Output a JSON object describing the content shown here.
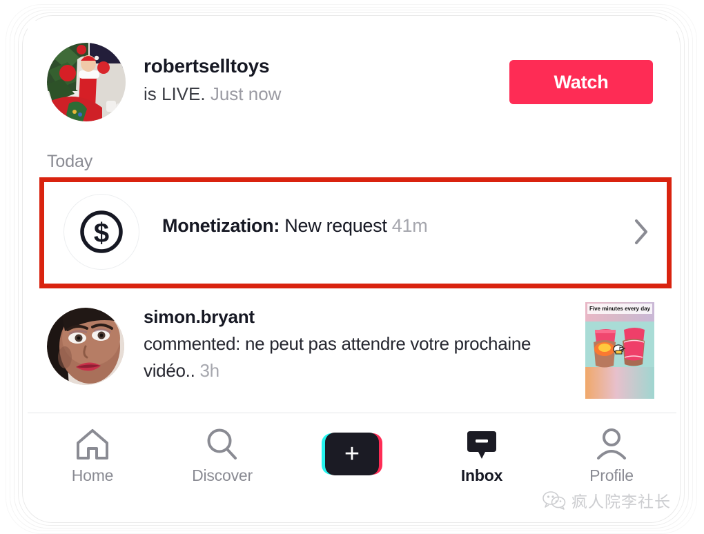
{
  "live_notification": {
    "avatar_alt": "christmas-stocking-avatar",
    "username": "robertselltoys",
    "status_text": "is LIVE.",
    "time_text": "Just now",
    "watch_label": "Watch",
    "watch_color": "#fe2c55"
  },
  "section": {
    "today_label": "Today"
  },
  "monetization": {
    "icon": "dollar-circle-icon",
    "title": "Monetization:",
    "detail": "New request",
    "time": "41m",
    "chevron": "chevron-right-icon",
    "highlight_color": "#d9230f"
  },
  "comment": {
    "avatar_alt": "woman-portrait-avatar",
    "username": "simon.bryant",
    "body": "commented: ne peut pas attendre votre prochaine vidéo..",
    "time": "3h",
    "thumbnail_caption": "Five minutes every day"
  },
  "bottom_nav": {
    "items": [
      {
        "label": "Home",
        "icon": "home-icon",
        "active": false
      },
      {
        "label": "Discover",
        "icon": "search-icon",
        "active": false
      },
      {
        "label": "",
        "icon": "create-plus-icon",
        "active": false
      },
      {
        "label": "Inbox",
        "icon": "inbox-bubble-icon",
        "active": true
      },
      {
        "label": "Profile",
        "icon": "person-icon",
        "active": false
      }
    ]
  },
  "watermark": {
    "icon": "wechat-icon",
    "text": "疯人院李社长"
  }
}
